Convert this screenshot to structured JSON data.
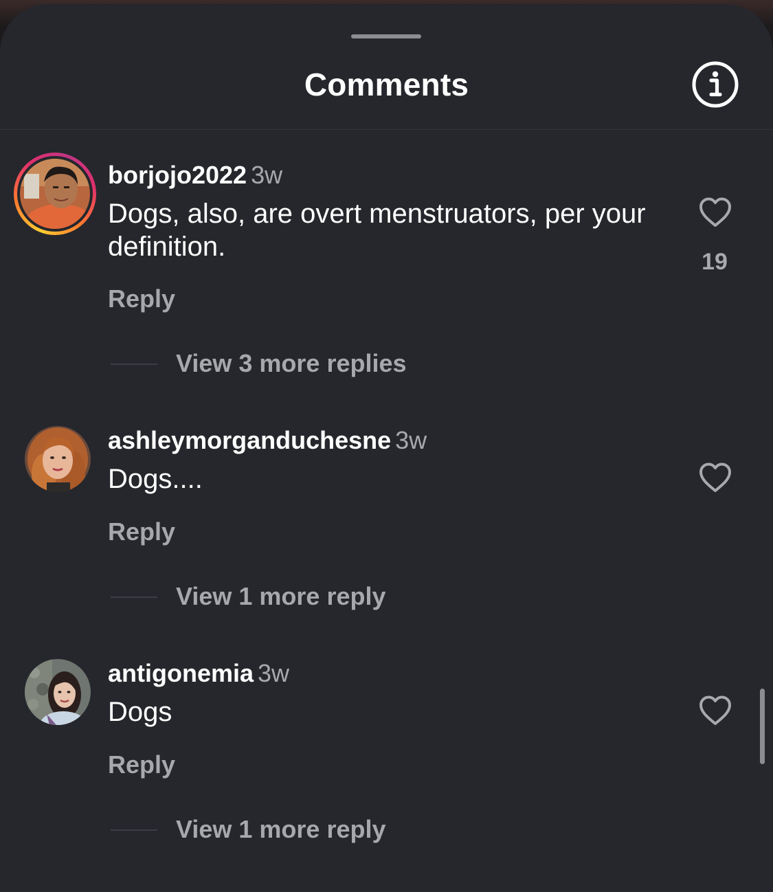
{
  "sheet": {
    "title": "Comments"
  },
  "icons": {
    "info": "info-circle-icon",
    "like": "heart-outline-icon",
    "grabber": "drag-handle"
  },
  "colors": {
    "background": "#25272c",
    "primary_text": "#ffffff",
    "secondary_text": "#a7a9ae",
    "story_ring": [
      "#ffcc33",
      "#ff7a2f",
      "#e1306c",
      "#c13584"
    ]
  },
  "comments": [
    {
      "username": "borjojo2022",
      "time": "3w",
      "text": "Dogs, also, are overt menstruators, per your definition.",
      "reply_label": "Reply",
      "like_count": "19",
      "has_story_ring": true,
      "replies_label": "View 3 more replies"
    },
    {
      "username": "ashleymorganduchesne",
      "time": "3w",
      "text": "Dogs....",
      "reply_label": "Reply",
      "like_count": "",
      "has_story_ring": false,
      "replies_label": "View 1 more reply"
    },
    {
      "username": "antigonemia",
      "time": "3w",
      "text": "Dogs",
      "reply_label": "Reply",
      "like_count": "",
      "has_story_ring": false,
      "replies_label": "View 1 more reply"
    }
  ]
}
